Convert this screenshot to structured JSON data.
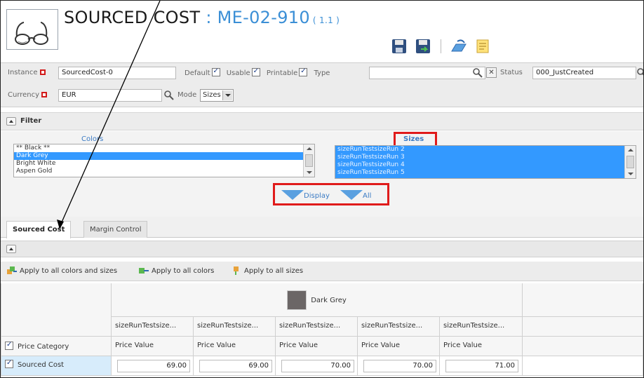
{
  "header": {
    "title": "SOURCED COST",
    "code": ": ME-02-910",
    "version": "( 1.1 )"
  },
  "toolbar": {
    "icons": [
      "save-icon",
      "save-and-close-icon",
      "open-icon",
      "notes-icon"
    ]
  },
  "instance": {
    "instance_label": "Instance",
    "instance_value": "SourcedCost-0",
    "default_label": "Default",
    "usable_label": "Usable",
    "printable_label": "Printable",
    "type_label": "Type",
    "type_value": "",
    "status_label": "Status",
    "status_value": "000_JustCreated",
    "currency_label": "Currency",
    "currency_value": "EUR",
    "mode_label": "Mode",
    "mode_value": "Sizes"
  },
  "filter": {
    "title": "Filter",
    "colors_title": "Colors",
    "colors": [
      "** Black **",
      "Dark Grey",
      "Bright White",
      "Aspen Gold"
    ],
    "colors_selected_index": 1,
    "sizes_title": "Sizes",
    "sizes": [
      "sizeRunTestsizeRun 2",
      "sizeRunTestsizeRun 3",
      "sizeRunTestsizeRun 4",
      "sizeRunTestsizeRun 5"
    ],
    "display_label": "Display",
    "all_label": "All"
  },
  "tabs": [
    {
      "label": "Sourced Cost",
      "active": true
    },
    {
      "label": "Margin Control",
      "active": false
    }
  ],
  "apply": {
    "all_colors_sizes": "Apply to all colors and sizes",
    "all_colors": "Apply to all colors",
    "all_sizes": "Apply to all sizes"
  },
  "grid": {
    "color_name": "Dark Grey",
    "color_hex": "#6b6666",
    "size_headers": [
      "sizeRunTestsize...",
      "sizeRunTestsize...",
      "sizeRunTestsize...",
      "sizeRunTestsize...",
      "sizeRunTestsize..."
    ],
    "category_header": "Price Category",
    "value_header": "Price Value",
    "rows": [
      {
        "label": "Sourced Cost",
        "values": [
          "69.00",
          "69.00",
          "70.00",
          "70.00",
          "71.00"
        ]
      }
    ]
  }
}
